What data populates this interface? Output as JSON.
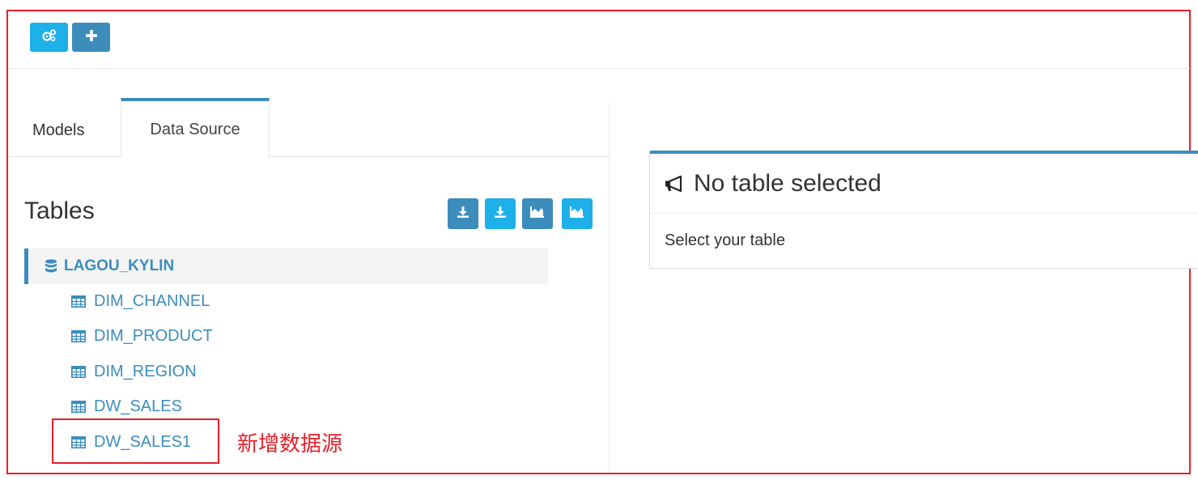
{
  "toolbar": {
    "icons": [
      "gears-icon",
      "plus-icon"
    ]
  },
  "tabs": [
    {
      "label": "Models",
      "active": false
    },
    {
      "label": "Data Source",
      "active": true
    }
  ],
  "tables_panel": {
    "title": "Tables",
    "action_icons": [
      "download-icon",
      "download-icon",
      "area-chart-icon",
      "area-chart-icon"
    ],
    "database": {
      "name": "LAGOU_KYLIN",
      "icon": "database-icon"
    },
    "tables": [
      {
        "name": "DIM_CHANNEL",
        "icon": "table-icon"
      },
      {
        "name": "DIM_PRODUCT",
        "icon": "table-icon"
      },
      {
        "name": "DIM_REGION",
        "icon": "table-icon"
      },
      {
        "name": "DW_SALES",
        "icon": "table-icon"
      },
      {
        "name": "DW_SALES1",
        "icon": "table-icon"
      }
    ]
  },
  "annotation": "新增数据源",
  "detail_panel": {
    "title": "No table selected",
    "icon": "bullhorn-icon",
    "message": "Select your table"
  },
  "colors": {
    "primary": "#3c8dbc",
    "info": "#1eb0e8",
    "annotation_red": "#e8202a"
  }
}
